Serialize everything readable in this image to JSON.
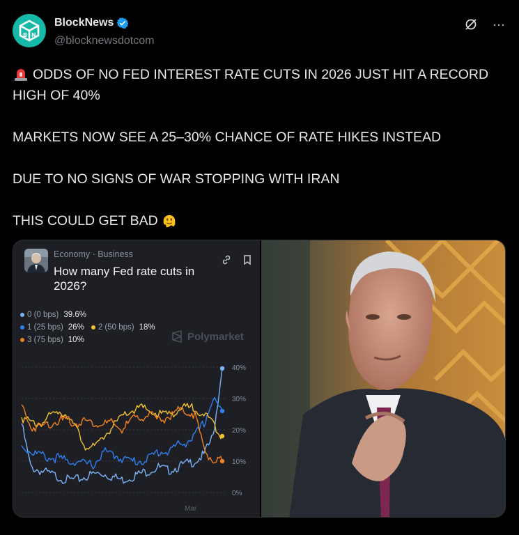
{
  "author": {
    "display_name": "BlockNews",
    "handle": "@blocknewsdotcom",
    "verified": true,
    "avatar_color": "#16b9a7"
  },
  "header_icons": [
    "grok-icon",
    "more-icon"
  ],
  "more_label": "···",
  "tweet": {
    "lines": [
      "ODDS OF NO FED INTEREST RATE CUTS IN 2026 JUST HIT A RECORD HIGH OF 40%",
      "MARKETS NOW SEE A 25–30% CHANCE OF RATE HIKES INSTEAD",
      "DUE TO NO SIGNS OF WAR STOPPING WITH IRAN",
      "THIS COULD GET BAD"
    ],
    "lead_emoji": "police-light-emoji",
    "trail_emoji": "melting-face-emoji"
  },
  "market_card": {
    "category": "Economy · Business",
    "title": "How many Fed rate cuts in 2026?",
    "brand": "Polymarket",
    "legend": [
      {
        "label": "0 (0 bps)",
        "value": "39.6%",
        "color": "#7cb3f5"
      },
      {
        "label": "1 (25 bps)",
        "value": "26%",
        "color": "#2f7ff0"
      },
      {
        "label": "2 (50 bps)",
        "value": "18%",
        "color": "#f2c12e"
      },
      {
        "label": "3 (75 bps)",
        "value": "10%",
        "color": "#f4801f"
      }
    ]
  },
  "chart_data": {
    "type": "line",
    "x_tick_labels": [
      "Mar"
    ],
    "y_tick_labels": [
      "40%",
      "30%",
      "20%",
      "10%",
      "0%"
    ],
    "ylim": [
      0,
      40
    ],
    "grid": true,
    "series": [
      {
        "name": "0 (0 bps)",
        "color": "#7cb3f5",
        "values": [
          22,
          8,
          7,
          6,
          5,
          4,
          4,
          5,
          6,
          6,
          5,
          4,
          5,
          6,
          7,
          8,
          7,
          8,
          9,
          10,
          12,
          18,
          39.6
        ]
      },
      {
        "name": "1 (25 bps)",
        "color": "#2f7ff0",
        "values": [
          15,
          13,
          12,
          11,
          11,
          10,
          10,
          9,
          9,
          13,
          12,
          11,
          10,
          10,
          11,
          13,
          13,
          15,
          16,
          18,
          22,
          30,
          26
        ]
      },
      {
        "name": "2 (50 bps)",
        "color": "#f2c12e",
        "values": [
          24,
          22,
          22,
          24,
          26,
          25,
          20,
          15,
          14,
          18,
          21,
          24,
          26,
          27,
          26,
          25,
          25,
          26,
          27,
          27,
          25,
          22,
          18
        ]
      },
      {
        "name": "3 (75 bps)",
        "color": "#f4801f",
        "values": [
          28,
          21,
          21,
          22,
          23,
          23,
          22,
          23,
          22,
          22,
          22,
          20,
          23,
          24,
          25,
          23,
          24,
          26,
          26,
          25,
          14,
          10,
          10
        ]
      }
    ]
  },
  "colors": {
    "background": "#000000",
    "text": "#e7e9ea",
    "muted": "#71767b",
    "verified_blue": "#1d9bf0",
    "card_bg": "#1d1f24"
  }
}
